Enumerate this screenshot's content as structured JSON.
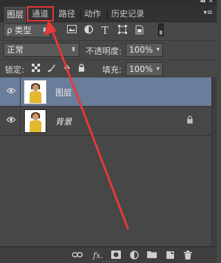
{
  "window": {
    "collapse_glyph": "◂◂",
    "close_glyph": "✕"
  },
  "tabs": [
    {
      "label": "图层",
      "active": true
    },
    {
      "label": "通道",
      "active": false
    },
    {
      "label": "路径",
      "active": false
    },
    {
      "label": "动作",
      "active": false
    },
    {
      "label": "历史记录",
      "active": false
    }
  ],
  "panel_menu_glyph": "▾≡",
  "filter": {
    "kind_label": "ρ 类型",
    "icons": [
      "image-filter-icon",
      "adjustment-filter-icon",
      "type-filter-icon",
      "shape-filter-icon",
      "smart-object-filter-icon"
    ]
  },
  "blend": {
    "mode": "正常",
    "opacity_label": "不透明度:",
    "opacity_value": "100%"
  },
  "lock": {
    "label": "锁定:",
    "icons": [
      "lock-transparent-icon",
      "lock-image-icon",
      "lock-position-icon",
      "lock-all-icon"
    ],
    "fill_label": "填充:",
    "fill_value": "100%"
  },
  "layers": [
    {
      "name": "图层",
      "selected": true,
      "locked": false
    },
    {
      "name": "背景",
      "selected": false,
      "locked": true
    }
  ],
  "bottom_icons": [
    "link-icon",
    "fx-icon",
    "mask-icon",
    "adjustment-icon",
    "group-icon",
    "new-layer-icon",
    "trash-icon"
  ],
  "colors": {
    "selection": "#6a7d9a",
    "annotation": "#e8393a",
    "panel": "#474747"
  }
}
